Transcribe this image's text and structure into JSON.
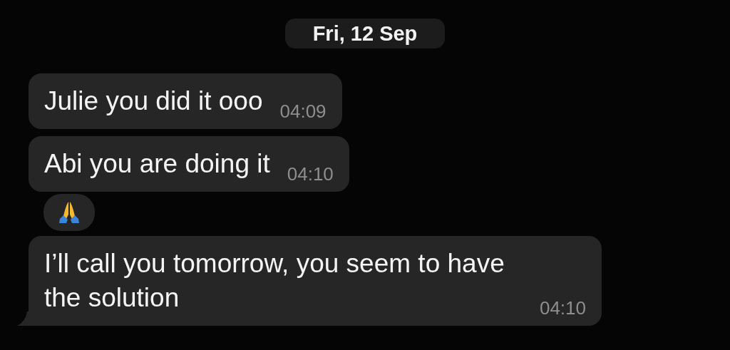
{
  "date_divider": "Fri, 12 Sep",
  "messages": [
    {
      "text": "Julie you did it ooo",
      "time": "04:09",
      "has_reaction": false,
      "tail": false
    },
    {
      "text": "Abi you are doing it",
      "time": "04:10",
      "has_reaction": true,
      "tail": false
    },
    {
      "text": "I’ll call you tomorrow, you seem to have the solution",
      "time": "04:10",
      "has_reaction": false,
      "tail": true
    }
  ]
}
